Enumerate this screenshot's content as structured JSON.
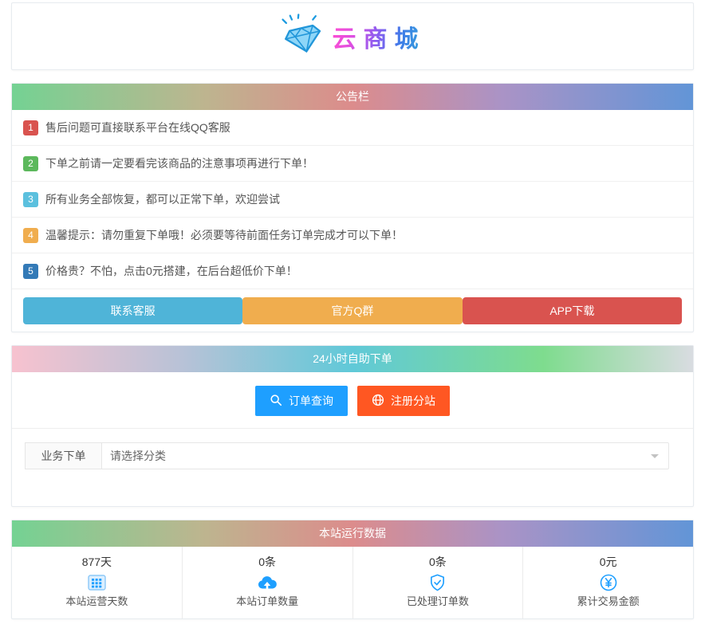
{
  "logo": {
    "title": "云商城"
  },
  "announcement": {
    "header": "公告栏",
    "items": [
      {
        "num": "1",
        "color": "#d9534f",
        "text": "售后问题可直接联系平台在线QQ客服"
      },
      {
        "num": "2",
        "color": "#5cb85c",
        "text": "下单之前请一定要看完该商品的注意事项再进行下单！"
      },
      {
        "num": "3",
        "color": "#5bc0de",
        "text": "所有业务全部恢复，都可以正常下单，欢迎尝试"
      },
      {
        "num": "4",
        "color": "#f0ad4e",
        "text": "温馨提示：请勿重复下单哦！必须要等待前面任务订单完成才可以下单！"
      },
      {
        "num": "5",
        "color": "#337ab7",
        "text": "价格贵？不怕，点击0元搭建，在后台超低价下单！"
      }
    ],
    "buttons": [
      {
        "label": "联系客服",
        "color": "#4fb4d8"
      },
      {
        "label": "官方Q群",
        "color": "#f0ad4e"
      },
      {
        "label": "APP下载",
        "color": "#d9534f"
      }
    ]
  },
  "order": {
    "header": "24小时自助下单",
    "query_button": "订单查询",
    "register_button": "注册分站",
    "form_label": "业务下单",
    "select_value": "请选择分类"
  },
  "stats": {
    "header": "本站运行数据",
    "items": [
      {
        "value": "877天",
        "label": "本站运营天数",
        "icon": "calendar-grid-icon"
      },
      {
        "value": "0条",
        "label": "本站订单数量",
        "icon": "cloud-upload-icon"
      },
      {
        "value": "0条",
        "label": "已处理订单数",
        "icon": "shield-check-icon"
      },
      {
        "value": "0元",
        "label": "累计交易金额",
        "icon": "yen-circle-icon"
      }
    ]
  },
  "colors": {
    "accent_blue": "#1E9FFF",
    "accent_orange": "#FF5722",
    "header_gradient_a": "#74d293,#dc8c8c,#6295d7",
    "header_gradient_b": "#f7c2cf,#60c9d8,#7edc8e"
  }
}
